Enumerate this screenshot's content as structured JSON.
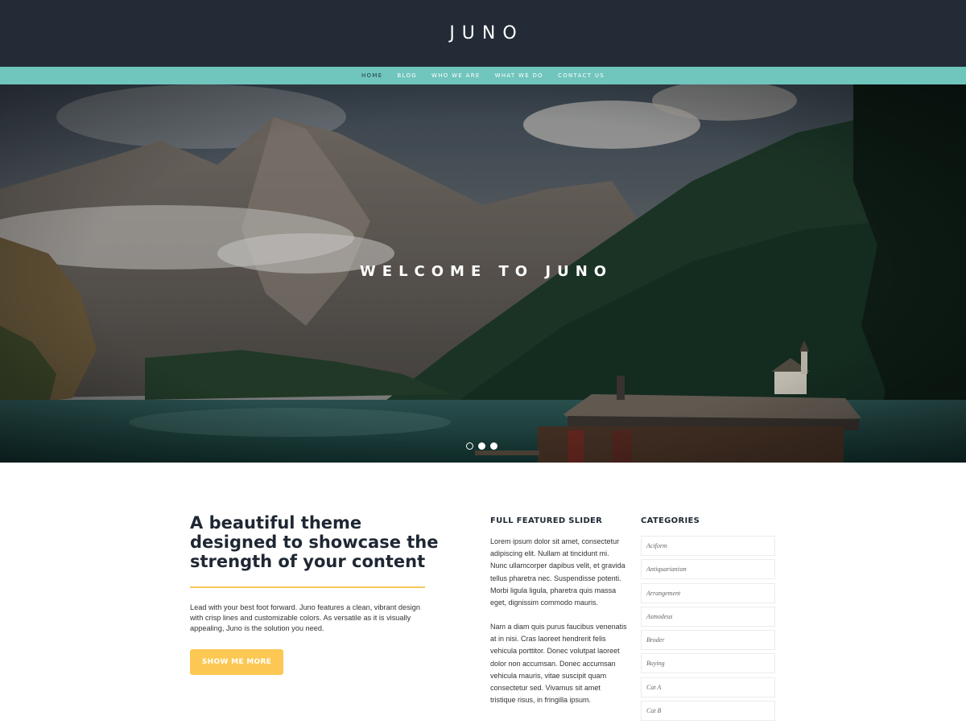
{
  "header": {
    "site_title": "JUNO"
  },
  "nav": {
    "items": [
      {
        "label": "HOME"
      },
      {
        "label": "BLOG"
      },
      {
        "label": "WHO WE ARE"
      },
      {
        "label": "WHAT WE DO"
      },
      {
        "label": "CONTACT US"
      }
    ]
  },
  "hero": {
    "title": "WELCOME TO JUNO",
    "slides_total": 3,
    "active_slide": 1
  },
  "intro": {
    "heading": "A beautiful theme designed to showcase the strength of your content",
    "text": "Lead with your best foot forward. Juno features a clean, vibrant design with crisp lines and customizable colors. As versatile as it is visually appealing, Juno is the solution you need.",
    "button_label": "SHOW ME MORE"
  },
  "slider_widget": {
    "title": "FULL FEATURED SLIDER",
    "paragraphs": [
      "Lorem ipsum dolor sit amet, consectetur adipiscing elit. Nullam at tincidunt mi. Nunc ullamcorper dapibus velit, et gravida tellus pharetra nec. Suspendisse potenti. Morbi ligula ligula, pharetra quis massa eget, dignissim commodo mauris.",
      "Nam a diam quis purus faucibus venenatis at in nisi. Cras laoreet hendrerit felis vehicula porttitor. Donec volutpat laoreet dolor non accumsan. Donec accumsan vehicula mauris, vitae suscipit quam consectetur sed. Vivamus sit amet tristique risus, in fringilla ipsum."
    ]
  },
  "categories_widget": {
    "title": "CATEGORIES",
    "items": [
      "Aciform",
      "Antiquarianism",
      "Arrangement",
      "Asmodeus",
      "Broder",
      "Buying",
      "Cat A",
      "Cat B"
    ]
  },
  "colors": {
    "header_bg": "#232b36",
    "nav_bg": "#70c5bd",
    "accent": "#fcc853",
    "rule": "#f6c85a",
    "heading_text": "#1e2733"
  },
  "icons": {
    "slider_dots": "circle-dot-icon"
  }
}
